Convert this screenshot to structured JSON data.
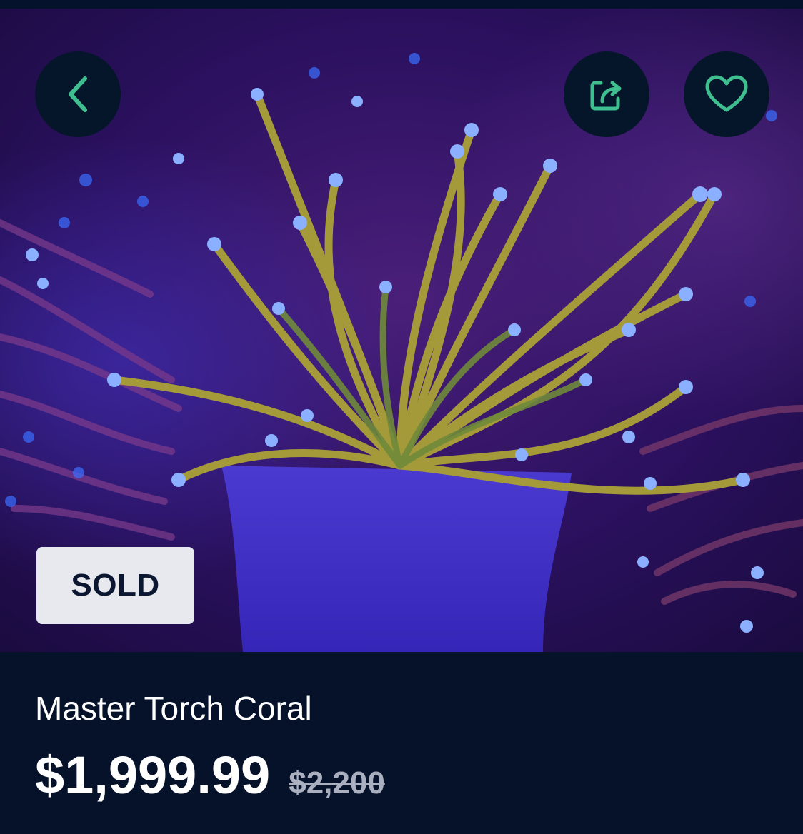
{
  "colors": {
    "background": "#06112a",
    "icon_accent": "#3fbf8f",
    "button_bg": "#06162a",
    "badge_bg": "#e8e9ee",
    "badge_text": "#0b1630",
    "old_price": "#aab0bf"
  },
  "hero": {
    "image_alt": "Master Torch Coral photo",
    "back_icon": "chevron-left-icon",
    "share_icon": "share-icon",
    "favorite_icon": "heart-icon",
    "status_badge": "SOLD"
  },
  "product": {
    "title": "Master Torch Coral",
    "price": "$1,999.99",
    "original_price": "$2,200"
  }
}
